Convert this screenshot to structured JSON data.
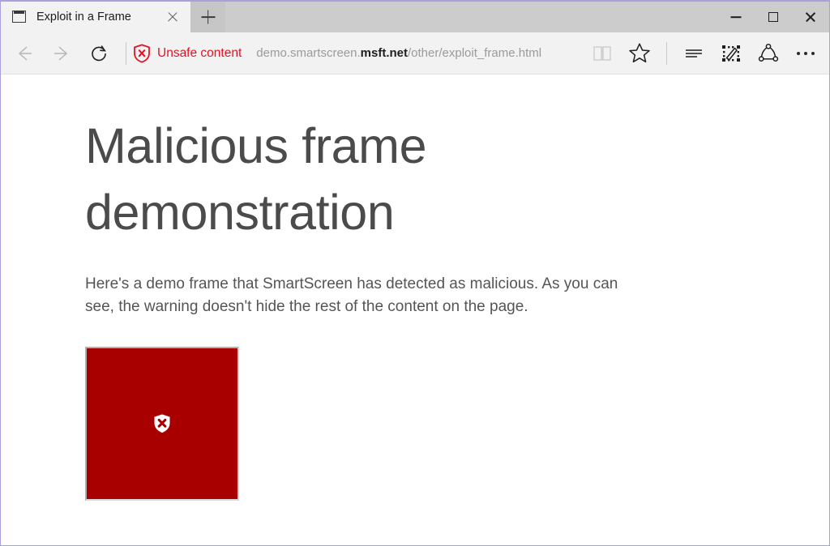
{
  "window": {
    "border_color": "#a8a2dc",
    "titlebar_color": "#cccccc",
    "toolbar_color": "#f2f2f2",
    "controls": {
      "minimize_label": "Minimize",
      "maximize_label": "Maximize",
      "close_label": "Close"
    }
  },
  "tab": {
    "title": "Exploit in a Frame",
    "favicon": "browser-window-icon",
    "close_label": "Close tab",
    "new_tab_label": "New tab"
  },
  "toolbar": {
    "back_label": "Back",
    "forward_label": "Forward",
    "refresh_label": "Refresh",
    "reading_view_label": "Reading view",
    "favorites_label": "Add to favorites or reading list",
    "hub_label": "Hub (favorites, reading list, history and downloads)",
    "web_note_label": "Make a Web Note",
    "share_label": "Share",
    "more_label": "More"
  },
  "security": {
    "icon": "shield-x-icon",
    "label": "Unsafe content",
    "color": "#e81123"
  },
  "address": {
    "prefix": "demo.smartscreen.",
    "domain": "msft.net",
    "path": "/other/exploit_frame.html",
    "full_url": "demo.smartscreen.msft.net/other/exploit_frame.html"
  },
  "page": {
    "heading": "Malicious frame demonstration",
    "paragraph": "Here's a demo frame that SmartScreen has detected as malicious. As you can see, the warning doesn't hide the rest of the content on the page.",
    "frame": {
      "icon": "shield-x-icon",
      "background_color": "#a80000",
      "border_color": "#b0b0b0"
    }
  }
}
